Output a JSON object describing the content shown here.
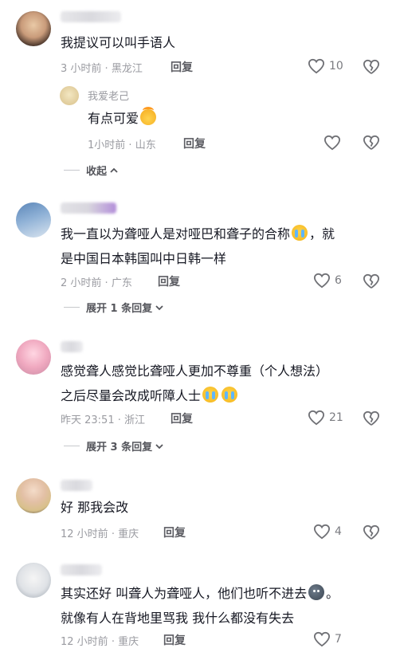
{
  "colors": {
    "text": "#161823",
    "meta": "#9a9ba1",
    "reply": "#5c5d63",
    "icon": "#7a7b80"
  },
  "comments": [
    {
      "name": "",
      "text_lines": [
        "我提议可以叫手语人"
      ],
      "time": "3 小时前",
      "location": "黑龙江",
      "reply_label": "回复",
      "likes": "10",
      "replies": [
        {
          "name": "我爱老己",
          "text": "有点可爱",
          "emoji": "cute-face",
          "time": "1小时前",
          "location": "山东",
          "reply_label": "回复"
        }
      ],
      "collapse_label": "收起"
    },
    {
      "name": "",
      "text_line1": "我一直以为聋哑人是对哑巴和聋子的合称",
      "text_line1_after": "，就",
      "text_line2": "是中国日本韩国叫中日韩一样",
      "emoji": "crying-face",
      "time": "2 小时前",
      "location": "广东",
      "reply_label": "回复",
      "likes": "6",
      "expand_label": "展开 1 条回复"
    },
    {
      "name": "",
      "text_line1": "感觉聋人感觉比聋哑人更加不尊重（个人想法）",
      "text_line2": "之后尽量会改成听障人士",
      "emoji": "crying-face",
      "time": "昨天 23:51",
      "location": "浙江",
      "reply_label": "回复",
      "likes": "21",
      "expand_label": "展开 3 条回复"
    },
    {
      "name": "",
      "text_line1": "好 那我会改",
      "time": "12 小时前",
      "location": "重庆",
      "reply_label": "回复",
      "likes": "4"
    },
    {
      "name": "",
      "text_line1": "其实还好 叫聋人为聋哑人，他们也听不进去",
      "text_line1_after": "。",
      "text_line2": "就像有人在背地里骂我 我什么都没有失去",
      "emoji": "dark-face",
      "time": "12 小时前",
      "location": "重庆",
      "reply_label": "回复",
      "likes": "7"
    }
  ],
  "icons": {
    "like": "heart-outline-icon",
    "dislike": "broken-heart-icon",
    "collapse": "chevron-up-icon",
    "expand": "chevron-down-icon"
  }
}
